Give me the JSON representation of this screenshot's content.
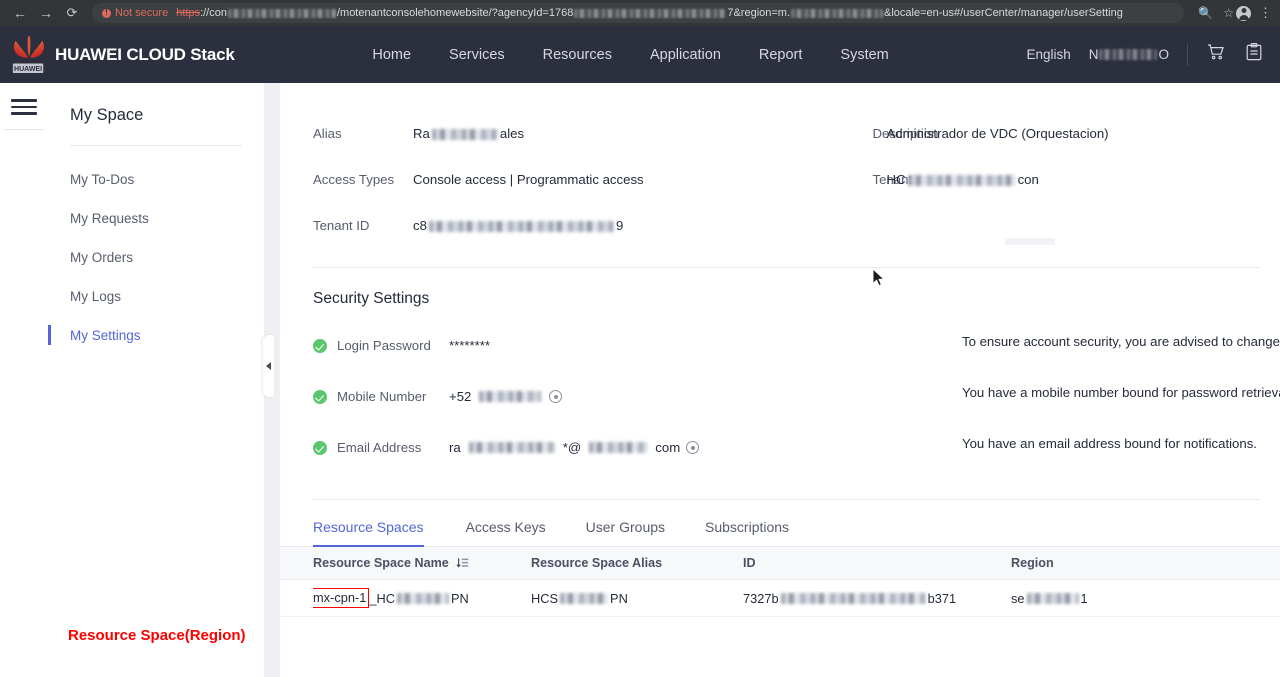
{
  "browser": {
    "back_icon": "back-arrow-icon",
    "forward_icon": "forward-arrow-icon",
    "reload_icon": "reload-icon",
    "security_label": "Not secure",
    "url_scheme": "https",
    "url_part1": "://con",
    "url_part2": "/motenantconsolehomewebsite/?agencyId=1768",
    "url_part3": "7&region=m.",
    "url_part4": "&locale=en-us#/userCenter/manager/userSetting",
    "zoom_icon": "zoom-search-icon",
    "bookmark_icon": "star-icon",
    "profile_icon": "profile-avatar-icon",
    "menu_icon": "three-dot-menu-icon"
  },
  "header": {
    "brand": "HUAWEI CLOUD Stack",
    "logo_icon": "huawei-flower-logo-icon",
    "nav": [
      {
        "label": "Home"
      },
      {
        "label": "Services"
      },
      {
        "label": "Resources"
      },
      {
        "label": "Application"
      },
      {
        "label": "Report"
      },
      {
        "label": "System"
      }
    ],
    "language": "English",
    "account_redacted": "N███████O",
    "cart_icon": "shopping-cart-icon",
    "clipboard_icon": "clipboard-icon"
  },
  "sidebar": {
    "menu_icon": "hamburger-menu-icon",
    "title": "My Space",
    "collapse_icon": "collapse-left-arrow-icon",
    "items": [
      {
        "label": "My To-Dos",
        "active": false
      },
      {
        "label": "My Requests",
        "active": false
      },
      {
        "label": "My Orders",
        "active": false
      },
      {
        "label": "My Logs",
        "active": false
      },
      {
        "label": "My Settings",
        "active": true
      }
    ]
  },
  "account_info": {
    "alias_label": "Alias",
    "alias_value_prefix": "Ra",
    "alias_value_suffix": "ales",
    "description_label": "Description",
    "description_value": "Administrador de VDC (Orquestacion)",
    "access_types_label": "Access Types",
    "access_types_value": "Console access | Programmatic access",
    "tenant_label": "Tenant",
    "tenant_value_prefix": "HC",
    "tenant_value_suffix": "con",
    "tenant_id_label": "Tenant ID",
    "tenant_id_prefix": "c8",
    "tenant_id_suffix": "9"
  },
  "security": {
    "title": "Security Settings",
    "rows": [
      {
        "status_icon": "green-check-icon",
        "label": "Login Password",
        "value": "********",
        "hint": "To ensure account security, you are advised to change your password periodically.",
        "has_eye": false
      },
      {
        "status_icon": "green-check-icon",
        "label": "Mobile Number",
        "value": "+52",
        "hint": "You have a mobile number bound for password retrieval.",
        "has_eye": true
      },
      {
        "status_icon": "green-check-icon",
        "label": "Email Address",
        "value_prefix": "ra",
        "value_mid": "*@",
        "value_suffix": "com",
        "hint": "You have an email address bound for notifications.",
        "has_eye": true
      }
    ]
  },
  "tabs": [
    {
      "label": "Resource Spaces",
      "active": true
    },
    {
      "label": "Access Keys",
      "active": false
    },
    {
      "label": "User Groups",
      "active": false
    },
    {
      "label": "Subscriptions",
      "active": false
    }
  ],
  "table": {
    "columns": [
      {
        "label": "Resource Space Name",
        "sort_icon": "sort-descending-icon"
      },
      {
        "label": "Resource Space Alias",
        "sort_icon": ""
      },
      {
        "label": "ID",
        "sort_icon": ""
      },
      {
        "label": "Region",
        "sort_icon": ""
      }
    ],
    "rows": [
      {
        "name_highlighted": "mx-cpn-1",
        "name_rest_prefix": "_HC",
        "name_rest_suffix": "PN",
        "alias_prefix": "HCS",
        "alias_suffix": "PN",
        "id_prefix": "7327b",
        "id_suffix": "b371",
        "region_prefix": "se",
        "region_suffix": "1"
      }
    ]
  },
  "annotation": {
    "text": "Resource Space(Region)",
    "color": "#ff0000"
  },
  "colors": {
    "brand_red": "#d2191f",
    "header_bg": "#2b2f3e",
    "accent_blue": "#5266d8",
    "success_green": "#5cc56f",
    "page_bg": "#f0f0f4"
  }
}
